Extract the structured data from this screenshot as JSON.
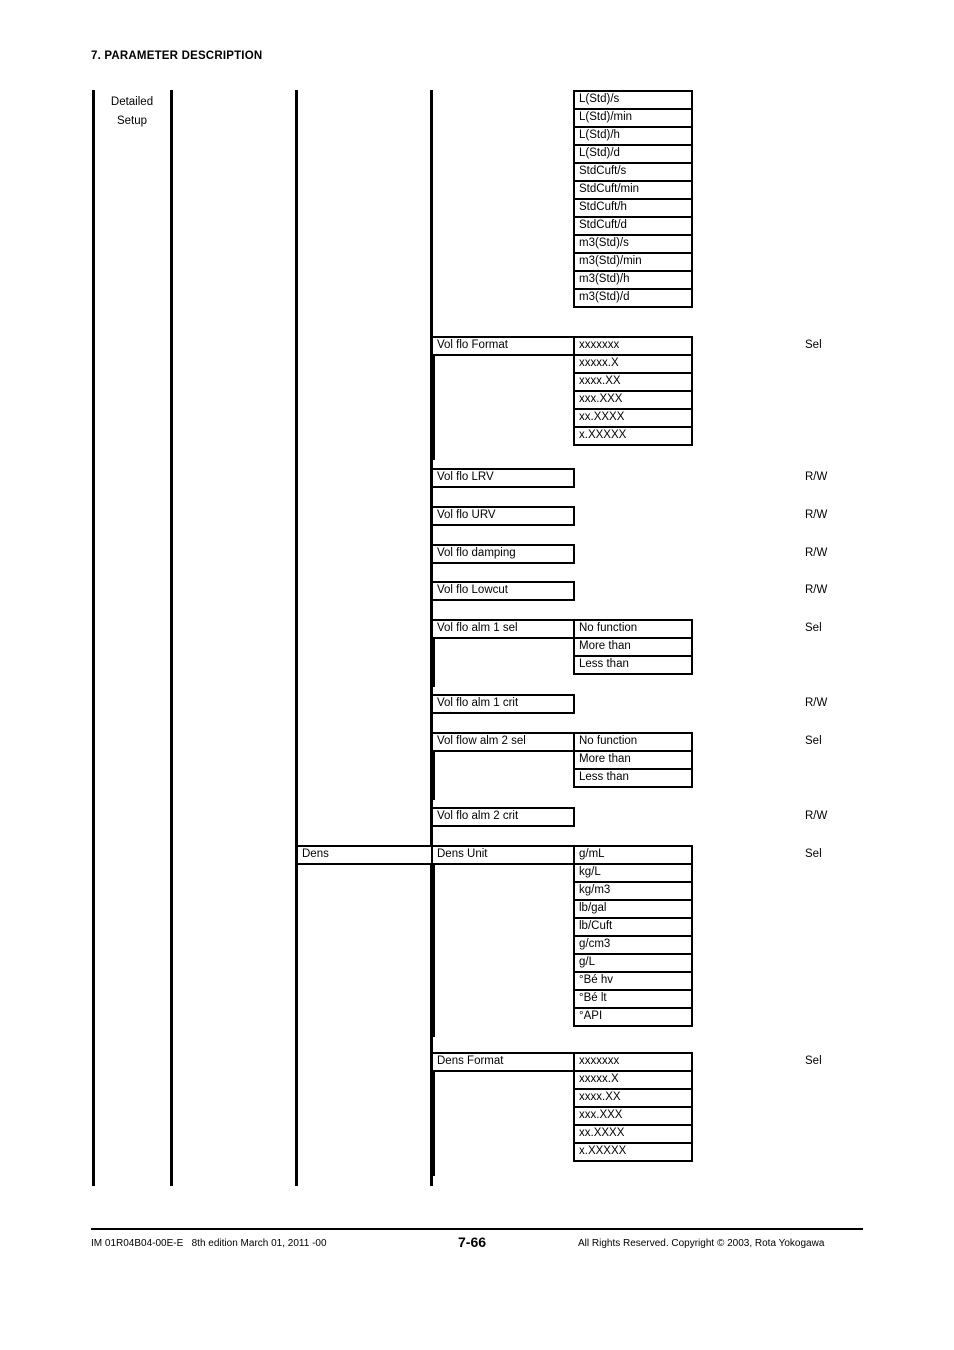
{
  "header": {
    "section_title": "7. PARAMETER DESCRIPTION"
  },
  "tree": {
    "group_label_line1": "Detailed",
    "group_label_line2": "Setup"
  },
  "vol_flo_unit_options": [
    "L(Std)/s",
    "L(Std)/min",
    "L(Std)/h",
    "L(Std)/d",
    "StdCuft/s",
    "StdCuft/min",
    "StdCuft/h",
    "StdCuft/d",
    "m3(Std)/s",
    "m3(Std)/min",
    "m3(Std)/h",
    "m3(Std)/d"
  ],
  "vol_flo_format": {
    "label": "Vol flo Format",
    "access": "Sel",
    "options": [
      "xxxxxxx",
      "xxxxx.X",
      "xxxx.XX",
      "xxx.XXX",
      "xx.XXXX",
      "x.XXXXX"
    ]
  },
  "vol_flo_lrv": {
    "label": "Vol flo LRV",
    "access": "R/W"
  },
  "vol_flo_urv": {
    "label": "Vol flo URV",
    "access": "R/W"
  },
  "vol_flo_damping": {
    "label": "Vol flo damping",
    "access": "R/W"
  },
  "vol_flo_lowcut": {
    "label": "Vol flo Lowcut",
    "access": "R/W"
  },
  "vol_flo_alm1_sel": {
    "label": "Vol flo alm 1 sel",
    "access": "Sel",
    "options": [
      "No function",
      "More than",
      "Less than"
    ]
  },
  "vol_flo_alm1_crit": {
    "label": "Vol flo alm 1 crit",
    "access": "R/W"
  },
  "vol_flo_alm2_sel": {
    "label": "Vol flow alm 2 sel",
    "access": "Sel",
    "options": [
      "No function",
      "More than",
      "Less than"
    ]
  },
  "vol_flo_alm2_crit": {
    "label": "Vol flo alm 2 crit",
    "access": "R/W"
  },
  "dens": {
    "label": "Dens"
  },
  "dens_unit": {
    "label": "Dens Unit",
    "access": "Sel",
    "options": [
      "g/mL",
      "kg/L",
      "kg/m3",
      "lb/gal",
      "lb/Cuft",
      "g/cm3",
      "g/L",
      "°Bé hv",
      "°Bé lt",
      "°API"
    ]
  },
  "dens_format": {
    "label": "Dens Format",
    "access": "Sel",
    "options": [
      "xxxxxxx",
      "xxxxx.X",
      "xxxx.XX",
      "xxx.XXX",
      "xx.XXXX",
      "x.XXXXX"
    ]
  },
  "footer": {
    "document_id": "IM 01R04B04-00E-E",
    "edition": "8th edition March 01, 2011 -00",
    "page_number": "7-66",
    "copyright": "All Rights Reserved. Copyright © 2003, Rota Yokogawa"
  }
}
